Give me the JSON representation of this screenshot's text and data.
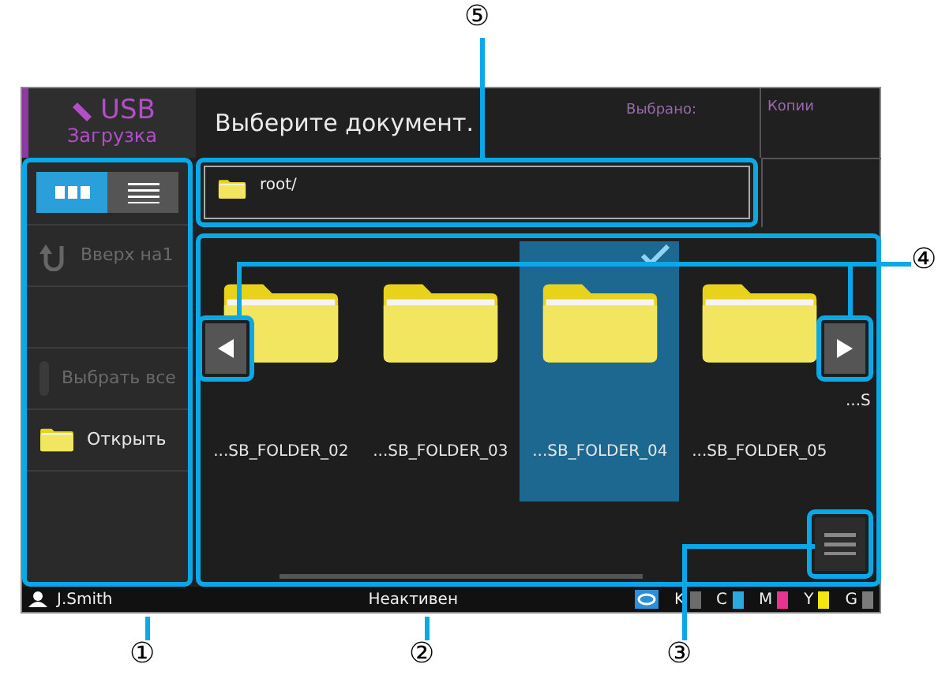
{
  "header": {
    "title": "USB",
    "subtitle": "Загрузка"
  },
  "prompt": "Выберите документ.",
  "selected_label": "Выбрано:",
  "copies_label": "Копии",
  "view_toggle": [
    {
      "kind": "grid",
      "selected": true
    },
    {
      "kind": "list",
      "selected": false
    }
  ],
  "sidebar": {
    "items": [
      {
        "kind": "up",
        "label": "Вверх на1",
        "disabled": true
      },
      {
        "kind": "blank"
      },
      {
        "kind": "select_all",
        "label": "Выбрать все",
        "disabled": true
      },
      {
        "kind": "open",
        "label": "Открыть",
        "disabled": false
      }
    ]
  },
  "path": "root/",
  "files": [
    {
      "name": "...SB_FOLDER_02",
      "selected": false
    },
    {
      "name": "...SB_FOLDER_03",
      "selected": false
    },
    {
      "name": "...SB_FOLDER_04",
      "selected": true
    },
    {
      "name": "...SB_FOLDER_05",
      "selected": false
    },
    {
      "name": "...S",
      "selected": false
    }
  ],
  "status_bar": {
    "user": "J.Smith",
    "state": "Неактивен",
    "inks": [
      {
        "label": "K",
        "color": "#6b6b6b"
      },
      {
        "label": "C",
        "color": "#29abe2"
      },
      {
        "label": "M",
        "color": "#e8348f"
      },
      {
        "label": "Y",
        "color": "#f5e50f"
      },
      {
        "label": "G",
        "color": "#7a7a7a"
      }
    ]
  },
  "callouts": [
    {
      "label": "①"
    },
    {
      "label": "②"
    },
    {
      "label": "③"
    },
    {
      "label": "④"
    },
    {
      "label": "⑤"
    }
  ]
}
